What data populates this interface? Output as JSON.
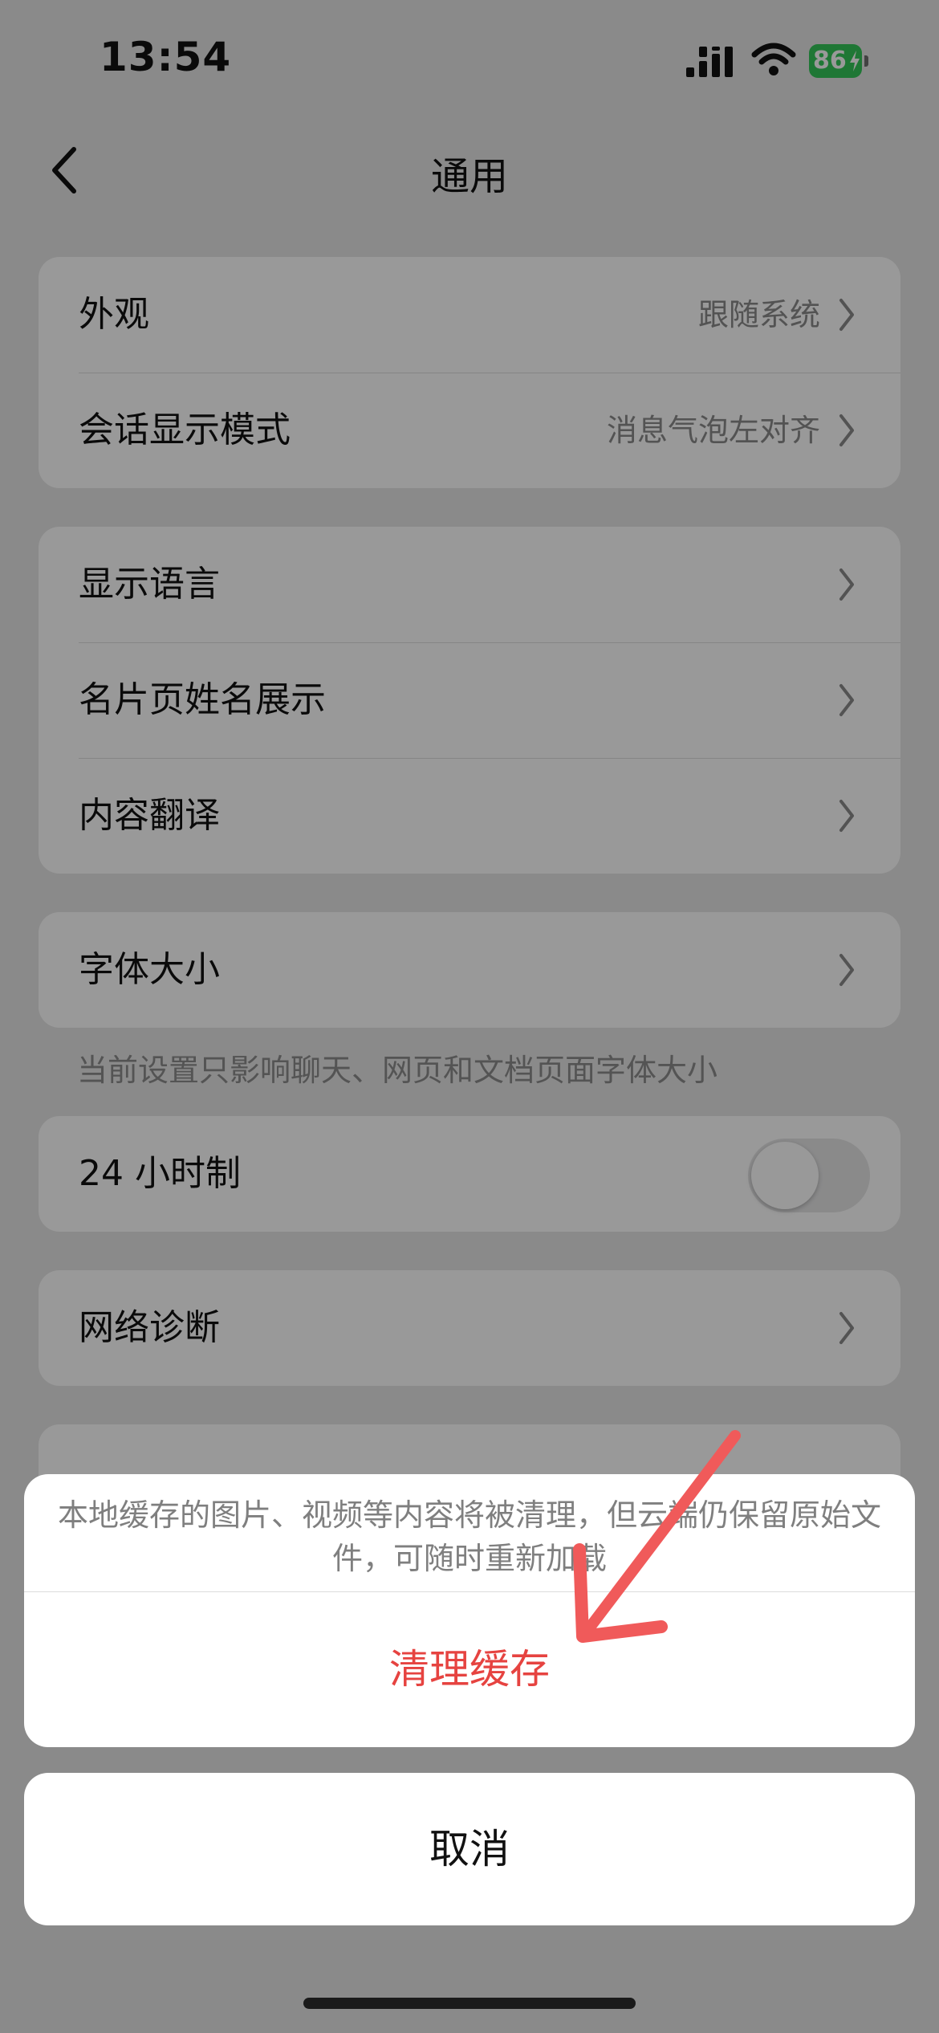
{
  "status_bar": {
    "time": "13:54",
    "battery": "86"
  },
  "nav": {
    "title": "通用"
  },
  "groups": {
    "appearance": [
      {
        "label": "外观",
        "value": "跟随系统"
      },
      {
        "label": "会话显示模式",
        "value": "消息气泡左对齐"
      }
    ],
    "language": [
      {
        "label": "显示语言"
      },
      {
        "label": "名片页姓名展示"
      },
      {
        "label": "内容翻译"
      }
    ],
    "font": {
      "label": "字体大小",
      "note": "当前设置只影响聊天、网页和文档页面字体大小"
    },
    "clock": {
      "label": "24 小时制",
      "toggle_on": false
    },
    "network": {
      "label": "网络诊断"
    }
  },
  "action_sheet": {
    "message": "本地缓存的图片、视频等内容将被清理，但云端仍保留原始文件，可随时重新加载",
    "action_label": "清理缓存",
    "cancel_label": "取消"
  },
  "colors": {
    "destructive": "#e64340",
    "annotation_arrow": "#f05a5a",
    "battery": "#34c759"
  }
}
